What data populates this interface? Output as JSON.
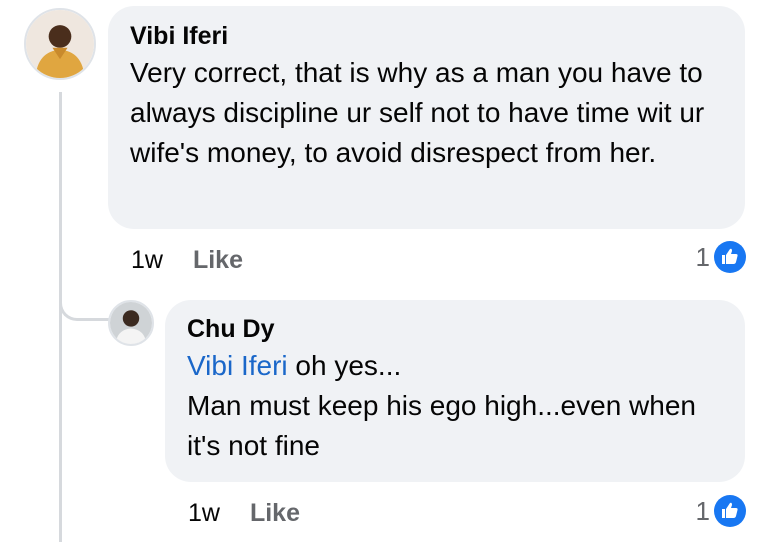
{
  "comments": [
    {
      "author": "Vibi Iferi",
      "text": "Very correct, that is why as a man you have to always discipline ur self not to have time wit ur wife's money, to avoid disrespect from her.",
      "time": "1w",
      "like_label": "Like",
      "reaction_count": "1",
      "reaction_icon": "thumbs-up-icon"
    }
  ],
  "replies": [
    {
      "author": "Chu Dy",
      "mention": "Vibi Iferi",
      "text_after_mention": "oh yes...",
      "text": "Man must keep his ego high...even when it's not fine",
      "time": "1w",
      "like_label": "Like",
      "reaction_count": "1",
      "reaction_icon": "thumbs-up-icon"
    }
  ],
  "colors": {
    "bubble_bg": "#f0f2f5",
    "mention": "#1a67c9",
    "like_badge": "#1877f2",
    "thread_line": "#d6d9dd"
  }
}
